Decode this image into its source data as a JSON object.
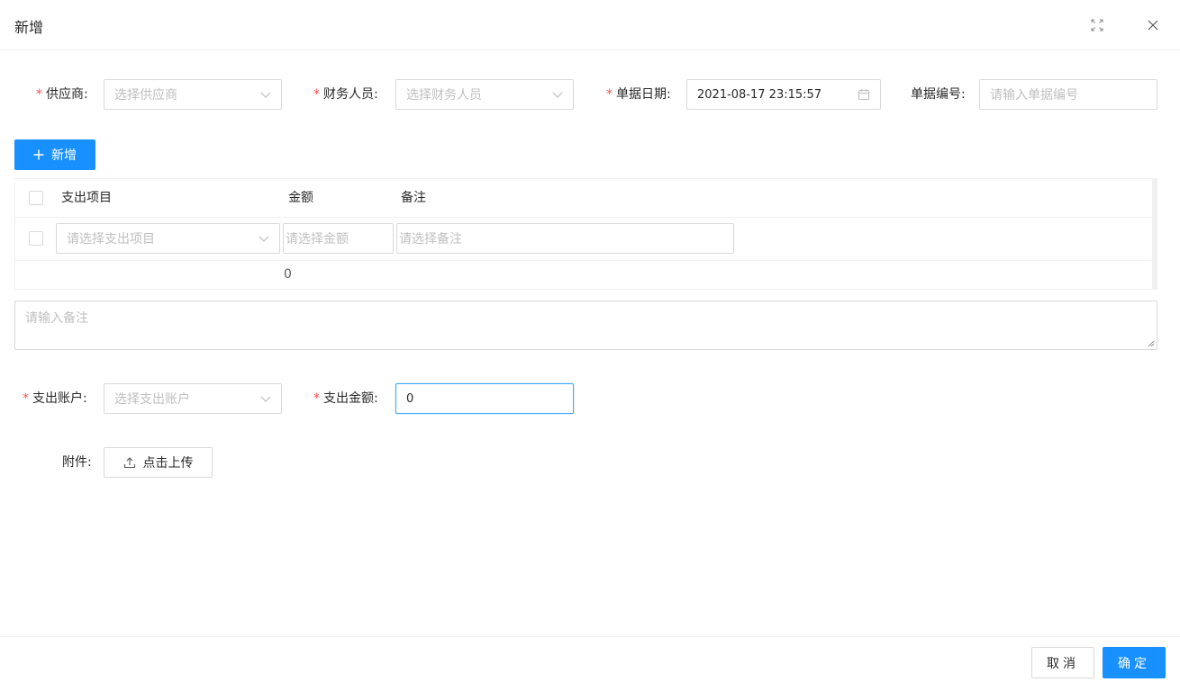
{
  "modal": {
    "title": "新增"
  },
  "form": {
    "supplier": {
      "label": "供应商",
      "placeholder": "选择供应商"
    },
    "finance_staff": {
      "label": "财务人员",
      "placeholder": "选择财务人员"
    },
    "doc_date": {
      "label": "单据日期",
      "value": "2021-08-17 23:15:57"
    },
    "doc_number": {
      "label": "单据编号",
      "placeholder": "请输入单据编号"
    },
    "add_button": "新增",
    "table": {
      "columns": [
        "支出项目",
        "金额",
        "备注"
      ],
      "row": {
        "item_placeholder": "请选择支出项目",
        "amount_placeholder": "请选择金额",
        "note_placeholder": "请选择备注"
      },
      "sum_amount": "0"
    },
    "remark_placeholder": "请输入备注",
    "expense_account": {
      "label": "支出账户",
      "placeholder": "选择支出账户"
    },
    "expense_amount": {
      "label": "支出金额",
      "value": "0"
    },
    "attachment": {
      "label": "附件",
      "upload_label": "点击上传"
    }
  },
  "footer": {
    "cancel_label": "取消",
    "confirm_label": "确定"
  },
  "colors": {
    "primary": "#1890ff",
    "required": "#ff4d4f",
    "border": "#d9d9d9",
    "placeholder": "#bfbfbf"
  },
  "icons": [
    "fullscreen-icon",
    "close-icon",
    "chevron-down-icon",
    "calendar-icon",
    "plus-icon",
    "upload-icon"
  ]
}
